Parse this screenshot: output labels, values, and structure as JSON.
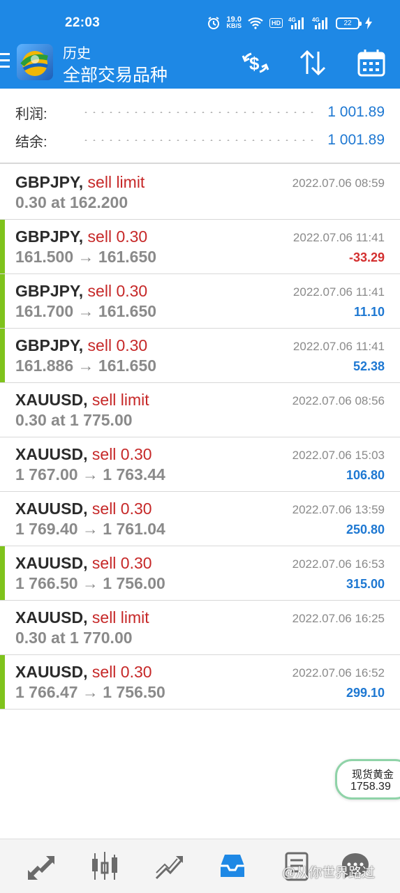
{
  "status_bar": {
    "time": "22:03",
    "net_speed_value": "19.0",
    "net_speed_unit": "KB/S",
    "hd_label": "HD",
    "signal_1_label": "4G",
    "signal_2_label": "4G",
    "battery": "22",
    "icons": [
      "alarm-icon",
      "wifi-icon",
      "hd-icon",
      "signal-icon",
      "signal-icon",
      "battery-icon",
      "charging-icon"
    ]
  },
  "app_bar": {
    "title": "历史",
    "subtitle": "全部交易品种",
    "buttons": [
      "currency-exchange-icon",
      "sort-icon",
      "calendar-icon"
    ]
  },
  "summary": {
    "profit_label": "利润:",
    "profit_value": "1 001.89",
    "balance_label": "结余:",
    "balance_value": "1 001.89"
  },
  "trades": [
    {
      "symbol": "GBPJPY,",
      "action": "sell limit",
      "prices": "0.30 at 162.200",
      "time": "2022.07.06 08:59",
      "profit": "",
      "profit_sign": "",
      "marked": false
    },
    {
      "symbol": "GBPJPY,",
      "action": "sell 0.30",
      "prices": "161.500 → 161.650",
      "time": "2022.07.06 11:41",
      "profit": "-33.29",
      "profit_sign": "neg",
      "marked": true
    },
    {
      "symbol": "GBPJPY,",
      "action": "sell 0.30",
      "prices": "161.700 → 161.650",
      "time": "2022.07.06 11:41",
      "profit": "11.10",
      "profit_sign": "pos",
      "marked": true
    },
    {
      "symbol": "GBPJPY,",
      "action": "sell 0.30",
      "prices": "161.886 → 161.650",
      "time": "2022.07.06 11:41",
      "profit": "52.38",
      "profit_sign": "pos",
      "marked": true
    },
    {
      "symbol": "XAUUSD,",
      "action": "sell limit",
      "prices": "0.30 at 1 775.00",
      "time": "2022.07.06 08:56",
      "profit": "",
      "profit_sign": "",
      "marked": false
    },
    {
      "symbol": "XAUUSD,",
      "action": "sell 0.30",
      "prices": "1 767.00 → 1 763.44",
      "time": "2022.07.06 15:03",
      "profit": "106.80",
      "profit_sign": "pos",
      "marked": false
    },
    {
      "symbol": "XAUUSD,",
      "action": "sell 0.30",
      "prices": "1 769.40 → 1 761.04",
      "time": "2022.07.06 13:59",
      "profit": "250.80",
      "profit_sign": "pos",
      "marked": false
    },
    {
      "symbol": "XAUUSD,",
      "action": "sell 0.30",
      "prices": "1 766.50 → 1 756.00",
      "time": "2022.07.06 16:53",
      "profit": "315.00",
      "profit_sign": "pos",
      "marked": true
    },
    {
      "symbol": "XAUUSD,",
      "action": "sell limit",
      "prices": "0.30 at 1 770.00",
      "time": "2022.07.06 16:25",
      "profit": "",
      "profit_sign": "",
      "marked": false
    },
    {
      "symbol": "XAUUSD,",
      "action": "sell 0.30",
      "prices": "1 766.47 → 1 756.50",
      "time": "2022.07.06 16:52",
      "profit": "299.10",
      "profit_sign": "pos",
      "marked": true
    }
  ],
  "floating_quote": {
    "name": "现货黄金",
    "price": "1758.39"
  },
  "bottom_nav": {
    "items": [
      "quotes-icon",
      "chart-icon",
      "trade-icon",
      "history-icon",
      "news-icon",
      "chat-icon"
    ],
    "active": "history-icon"
  },
  "watermark": "@从你世界路过",
  "colors": {
    "primary": "#1e88e5",
    "profit_positive": "#1e78d2",
    "profit_negative": "#d32f2f",
    "sell_action": "#c62828",
    "marker_bar": "#7fc31c"
  }
}
